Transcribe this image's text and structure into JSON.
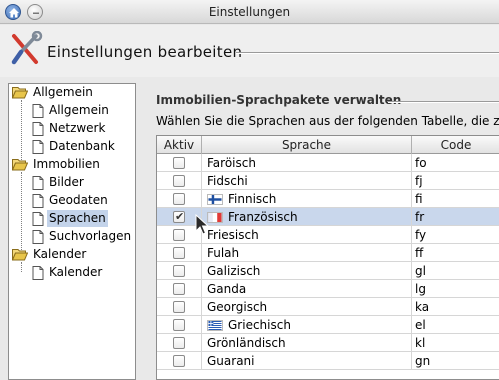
{
  "window": {
    "title": "Einstellungen"
  },
  "header": {
    "title": "Einstellungen bearbeiten"
  },
  "tree": {
    "groups": [
      {
        "label": "Allgemein",
        "children": [
          "Allgemein",
          "Netzwerk",
          "Datenbank"
        ]
      },
      {
        "label": "Immobilien",
        "children": [
          "Bilder",
          "Geodaten",
          "Sprachen",
          "Suchvorlagen"
        ]
      },
      {
        "label": "Kalender",
        "children": [
          "Kalender"
        ]
      }
    ],
    "selected": "Sprachen"
  },
  "panel": {
    "section_title": "Immobilien-Sprachpakete verwalten",
    "instruction": "Wählen Sie die Sprachen aus der folgenden Tabelle, die zur"
  },
  "table": {
    "columns": [
      "Aktiv",
      "Sprache",
      "Code"
    ],
    "rows": [
      {
        "active": false,
        "language": "Faröisch",
        "code": "fo",
        "flag": null,
        "selected": false
      },
      {
        "active": false,
        "language": "Fidschi",
        "code": "fj",
        "flag": null,
        "selected": false
      },
      {
        "active": false,
        "language": "Finnisch",
        "code": "fi",
        "flag": "finland-flag-icon",
        "selected": false
      },
      {
        "active": true,
        "language": "Französisch",
        "code": "fr",
        "flag": "france-flag-icon",
        "selected": true
      },
      {
        "active": false,
        "language": "Friesisch",
        "code": "fy",
        "flag": null,
        "selected": false
      },
      {
        "active": false,
        "language": "Fulah",
        "code": "ff",
        "flag": null,
        "selected": false
      },
      {
        "active": false,
        "language": "Galizisch",
        "code": "gl",
        "flag": null,
        "selected": false
      },
      {
        "active": false,
        "language": "Ganda",
        "code": "lg",
        "flag": null,
        "selected": false
      },
      {
        "active": false,
        "language": "Georgisch",
        "code": "ka",
        "flag": null,
        "selected": false
      },
      {
        "active": false,
        "language": "Griechisch",
        "code": "el",
        "flag": "greece-flag-icon",
        "selected": false
      },
      {
        "active": false,
        "language": "Grönländisch",
        "code": "kl",
        "flag": null,
        "selected": false
      },
      {
        "active": false,
        "language": "Guarani",
        "code": "gn",
        "flag": null,
        "selected": false
      }
    ]
  },
  "colors": {
    "selection": "#c9d7ec",
    "tree_selection": "#c3d3ea",
    "folder": "#e8c54a"
  }
}
